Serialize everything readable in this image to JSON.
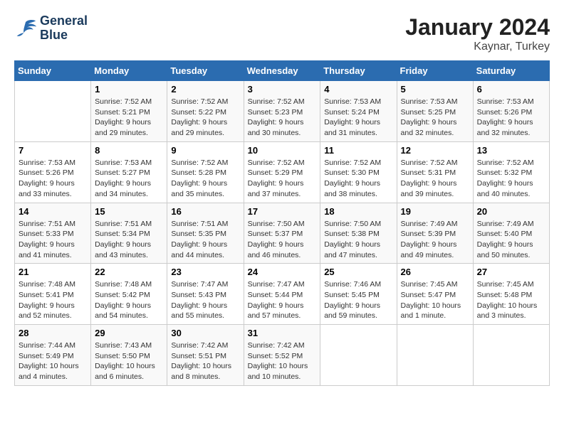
{
  "header": {
    "logo_line1": "General",
    "logo_line2": "Blue",
    "month": "January 2024",
    "location": "Kaynar, Turkey"
  },
  "weekdays": [
    "Sunday",
    "Monday",
    "Tuesday",
    "Wednesday",
    "Thursday",
    "Friday",
    "Saturday"
  ],
  "weeks": [
    [
      {
        "day": "",
        "info": ""
      },
      {
        "day": "1",
        "info": "Sunrise: 7:52 AM\nSunset: 5:21 PM\nDaylight: 9 hours\nand 29 minutes."
      },
      {
        "day": "2",
        "info": "Sunrise: 7:52 AM\nSunset: 5:22 PM\nDaylight: 9 hours\nand 29 minutes."
      },
      {
        "day": "3",
        "info": "Sunrise: 7:52 AM\nSunset: 5:23 PM\nDaylight: 9 hours\nand 30 minutes."
      },
      {
        "day": "4",
        "info": "Sunrise: 7:53 AM\nSunset: 5:24 PM\nDaylight: 9 hours\nand 31 minutes."
      },
      {
        "day": "5",
        "info": "Sunrise: 7:53 AM\nSunset: 5:25 PM\nDaylight: 9 hours\nand 32 minutes."
      },
      {
        "day": "6",
        "info": "Sunrise: 7:53 AM\nSunset: 5:26 PM\nDaylight: 9 hours\nand 32 minutes."
      }
    ],
    [
      {
        "day": "7",
        "info": "Sunrise: 7:53 AM\nSunset: 5:26 PM\nDaylight: 9 hours\nand 33 minutes."
      },
      {
        "day": "8",
        "info": "Sunrise: 7:53 AM\nSunset: 5:27 PM\nDaylight: 9 hours\nand 34 minutes."
      },
      {
        "day": "9",
        "info": "Sunrise: 7:52 AM\nSunset: 5:28 PM\nDaylight: 9 hours\nand 35 minutes."
      },
      {
        "day": "10",
        "info": "Sunrise: 7:52 AM\nSunset: 5:29 PM\nDaylight: 9 hours\nand 37 minutes."
      },
      {
        "day": "11",
        "info": "Sunrise: 7:52 AM\nSunset: 5:30 PM\nDaylight: 9 hours\nand 38 minutes."
      },
      {
        "day": "12",
        "info": "Sunrise: 7:52 AM\nSunset: 5:31 PM\nDaylight: 9 hours\nand 39 minutes."
      },
      {
        "day": "13",
        "info": "Sunrise: 7:52 AM\nSunset: 5:32 PM\nDaylight: 9 hours\nand 40 minutes."
      }
    ],
    [
      {
        "day": "14",
        "info": "Sunrise: 7:51 AM\nSunset: 5:33 PM\nDaylight: 9 hours\nand 41 minutes."
      },
      {
        "day": "15",
        "info": "Sunrise: 7:51 AM\nSunset: 5:34 PM\nDaylight: 9 hours\nand 43 minutes."
      },
      {
        "day": "16",
        "info": "Sunrise: 7:51 AM\nSunset: 5:35 PM\nDaylight: 9 hours\nand 44 minutes."
      },
      {
        "day": "17",
        "info": "Sunrise: 7:50 AM\nSunset: 5:37 PM\nDaylight: 9 hours\nand 46 minutes."
      },
      {
        "day": "18",
        "info": "Sunrise: 7:50 AM\nSunset: 5:38 PM\nDaylight: 9 hours\nand 47 minutes."
      },
      {
        "day": "19",
        "info": "Sunrise: 7:49 AM\nSunset: 5:39 PM\nDaylight: 9 hours\nand 49 minutes."
      },
      {
        "day": "20",
        "info": "Sunrise: 7:49 AM\nSunset: 5:40 PM\nDaylight: 9 hours\nand 50 minutes."
      }
    ],
    [
      {
        "day": "21",
        "info": "Sunrise: 7:48 AM\nSunset: 5:41 PM\nDaylight: 9 hours\nand 52 minutes."
      },
      {
        "day": "22",
        "info": "Sunrise: 7:48 AM\nSunset: 5:42 PM\nDaylight: 9 hours\nand 54 minutes."
      },
      {
        "day": "23",
        "info": "Sunrise: 7:47 AM\nSunset: 5:43 PM\nDaylight: 9 hours\nand 55 minutes."
      },
      {
        "day": "24",
        "info": "Sunrise: 7:47 AM\nSunset: 5:44 PM\nDaylight: 9 hours\nand 57 minutes."
      },
      {
        "day": "25",
        "info": "Sunrise: 7:46 AM\nSunset: 5:45 PM\nDaylight: 9 hours\nand 59 minutes."
      },
      {
        "day": "26",
        "info": "Sunrise: 7:45 AM\nSunset: 5:47 PM\nDaylight: 10 hours\nand 1 minute."
      },
      {
        "day": "27",
        "info": "Sunrise: 7:45 AM\nSunset: 5:48 PM\nDaylight: 10 hours\nand 3 minutes."
      }
    ],
    [
      {
        "day": "28",
        "info": "Sunrise: 7:44 AM\nSunset: 5:49 PM\nDaylight: 10 hours\nand 4 minutes."
      },
      {
        "day": "29",
        "info": "Sunrise: 7:43 AM\nSunset: 5:50 PM\nDaylight: 10 hours\nand 6 minutes."
      },
      {
        "day": "30",
        "info": "Sunrise: 7:42 AM\nSunset: 5:51 PM\nDaylight: 10 hours\nand 8 minutes."
      },
      {
        "day": "31",
        "info": "Sunrise: 7:42 AM\nSunset: 5:52 PM\nDaylight: 10 hours\nand 10 minutes."
      },
      {
        "day": "",
        "info": ""
      },
      {
        "day": "",
        "info": ""
      },
      {
        "day": "",
        "info": ""
      }
    ]
  ]
}
